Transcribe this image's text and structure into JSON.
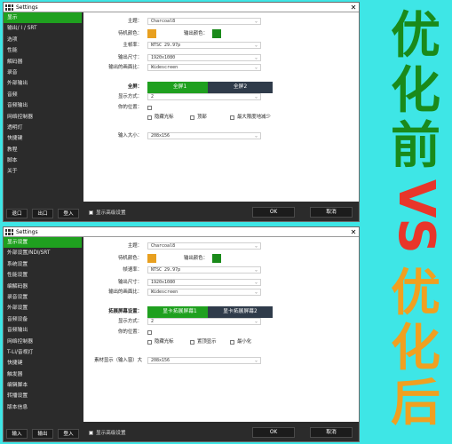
{
  "colors": {
    "background": "#3ee6e6",
    "active": "#1fa01f",
    "before_text": "#1a8a1a",
    "vs_text": "#e8362a",
    "after_text": "#f0a020",
    "swatch_orange": "#e8a020",
    "swatch_green": "#1a8a1a",
    "btn_dark": "#2f3b4a"
  },
  "big_text": {
    "before": [
      "优",
      "化",
      "前"
    ],
    "vs": "VS",
    "after": [
      "优",
      "化",
      "后"
    ]
  },
  "top": {
    "title": "Settings",
    "close": "✕",
    "sidebar": [
      "显示",
      "输出/ I / SRT",
      "选项",
      "性能",
      "解码器",
      "录音",
      "外部输出",
      "音频",
      "音频输出",
      "网络控制器",
      "透明灯",
      "快捷键",
      "教程",
      "脚本",
      "关于"
    ],
    "foot_buttons": [
      "退口",
      "出口",
      "登入"
    ],
    "footer": {
      "checkbox": "显示高级设置",
      "ok": "OK",
      "cancel": "取消"
    },
    "fields": {
      "theme_label": "主题：",
      "theme_value": "Charcoal8",
      "status_color_label": "待机颜色：",
      "output_color_label": "输出颜色：",
      "framerate_label": "主帧率：",
      "framerate_value": "NTSC 29.97p",
      "output_size_label": "输出尺寸：",
      "output_size_value": "1920x1080",
      "aspect_label": "输出的画面比：",
      "aspect_value": "Widescreen",
      "fullscreen_label": "全屏：",
      "fullscreen1": "全屏1",
      "fullscreen2": "全屏2",
      "display_mode_label": "显示方式：",
      "display_mode_value": "2",
      "position_label": "你的位置：",
      "check_hide_cursor": "隐藏光标",
      "check_topmost": "顶部",
      "check_max_res": "最大限度地减少",
      "input_size_label": "输入大小：",
      "input_size_value": "208x156"
    }
  },
  "bottom": {
    "title": "Settings",
    "close": "✕",
    "sidebar": [
      "显示设置",
      "外部设置/NDI/SRT",
      "系统设置",
      "性能设置",
      "编解码器",
      "录音设置",
      "外部设置",
      "音频设备",
      "音频输出",
      "网络控制器",
      "T-Li/音视打",
      "快捷键",
      "触发器",
      "编辑脚本",
      "转播设置",
      "版本信息"
    ],
    "foot_buttons": [
      "输入",
      "输出",
      "登入"
    ],
    "footer": {
      "checkbox": "显示高级设置",
      "ok": "OK",
      "cancel": "取消"
    },
    "fields": {
      "theme_label": "主题：",
      "theme_value": "Charcoal8",
      "status_color_label": "待机颜色：",
      "output_color_label": "输出颜色：",
      "framerate_label": "帧速率：",
      "framerate_value": "NTSC 29.97p",
      "output_size_label": "输出尺寸：",
      "output_size_value": "1920x1080",
      "aspect_label": "输出的画面比：",
      "aspect_value": "Widescreen",
      "fullscreen_label": "拓展屏幕设置：",
      "fullscreen1": "显卡拓展屏幕1",
      "fullscreen2": "显卡拓展屏幕2",
      "display_mode_label": "显示方式：",
      "display_mode_value": "2",
      "position_label": "你的位置：",
      "check_hide_cursor": "隐藏光标",
      "check_topmost": "置顶显示",
      "check_max_res": "最小化",
      "input_size_label": "素材显示（输入窗）大",
      "input_size_value": "208x156"
    }
  }
}
